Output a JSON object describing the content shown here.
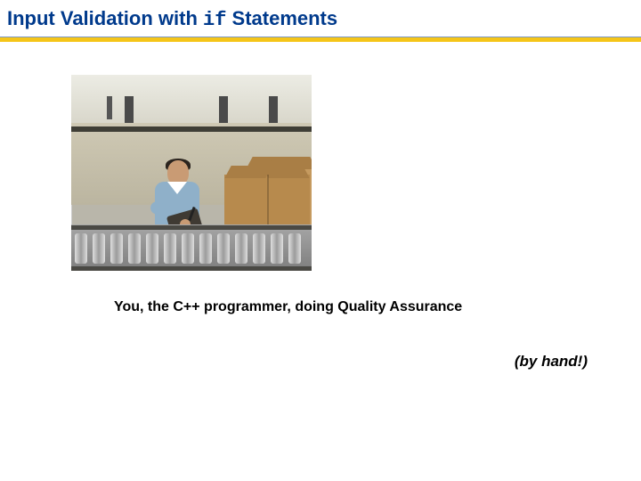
{
  "title": {
    "prefix": "Input Validation with ",
    "code": "if",
    "suffix": " Statements"
  },
  "caption": "You, the C++ programmer, doing Quality Assurance",
  "byhand": "(by hand!)"
}
